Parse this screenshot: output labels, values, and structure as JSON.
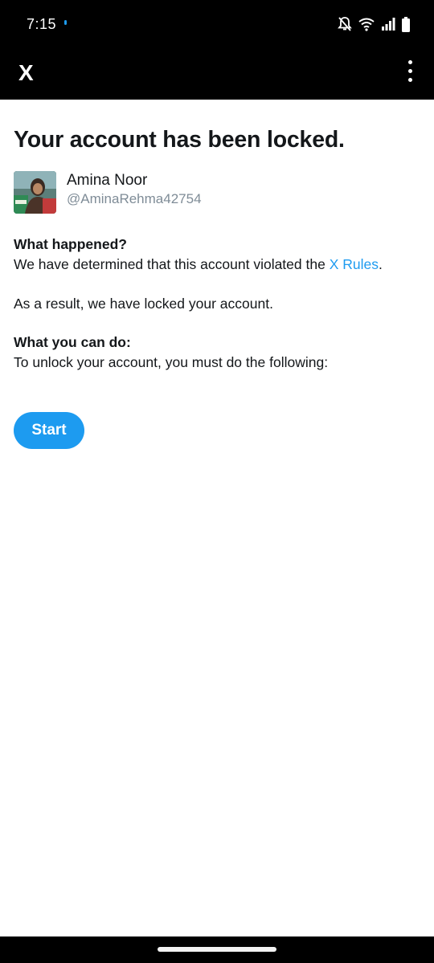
{
  "status_bar": {
    "time": "7:15",
    "icons": [
      "bell-off-icon",
      "wifi-icon",
      "signal-icon",
      "battery-icon"
    ]
  },
  "app_bar": {
    "logo": "X",
    "menu_icon": "more-vertical-icon"
  },
  "page": {
    "title": "Your account has been locked.",
    "user": {
      "name": "Amina Noor",
      "handle": "@AminaRehma42754"
    },
    "what_happened": {
      "title": "What happened?",
      "text_before_link": "We have determined that this account violated the ",
      "link_text": "X Rules",
      "text_after_link": "."
    },
    "result_text": "As a result, we have locked your account.",
    "what_you_can_do": {
      "title": "What you can do:",
      "text": "To unlock your account, you must do the following:"
    },
    "start_label": "Start"
  },
  "colors": {
    "accent": "#1d9bf0",
    "text": "#14171a",
    "secondary_text": "#7f8c97",
    "bars": "#000000"
  }
}
